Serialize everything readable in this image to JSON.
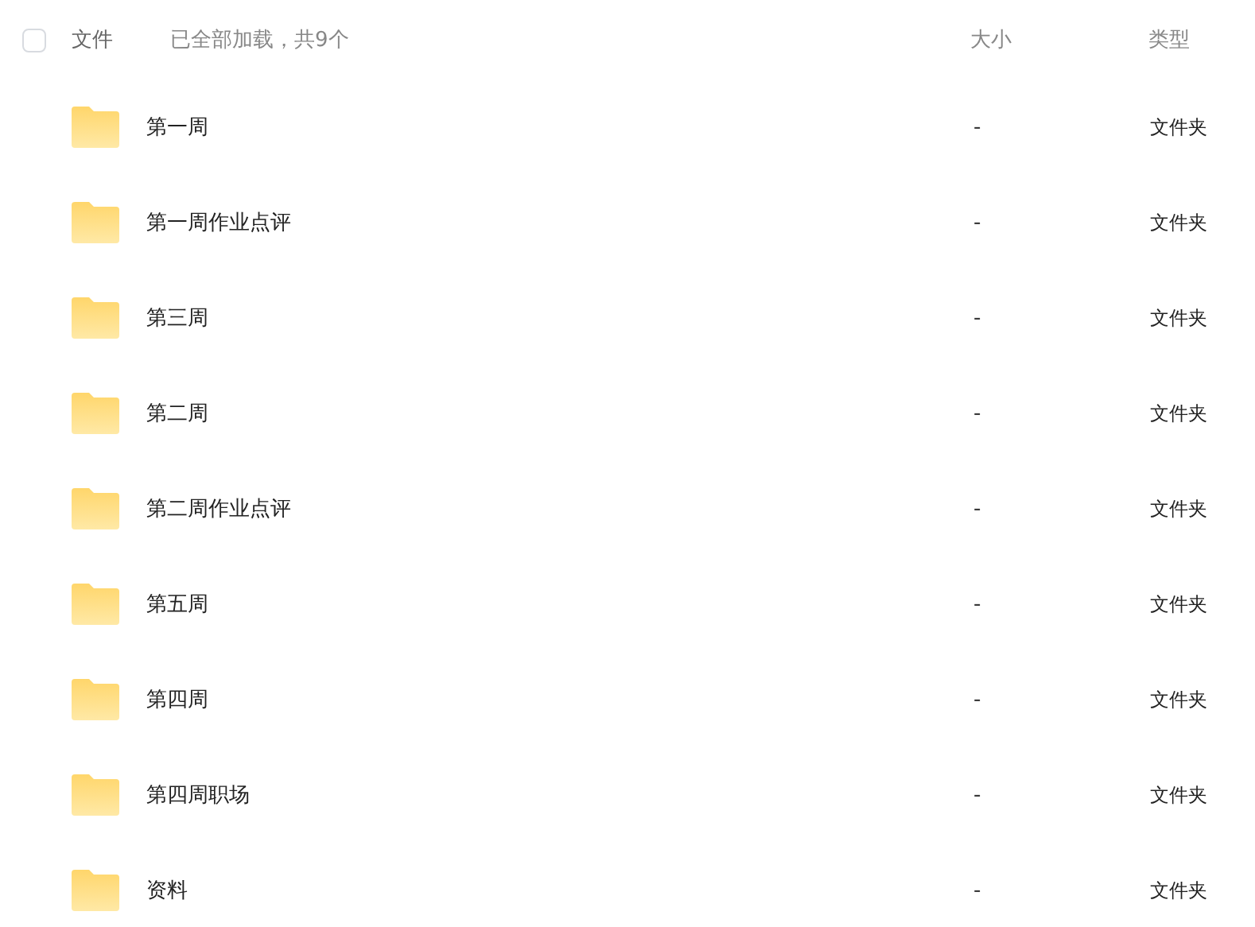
{
  "header": {
    "select_all": {
      "checked": false
    },
    "name_label": "文件",
    "load_status": "已全部加载，共9个",
    "size_label": "大小",
    "type_label": "类型"
  },
  "rows": [
    {
      "name": "第一周",
      "size": "-",
      "type": "文件夹"
    },
    {
      "name": "第一周作业点评",
      "size": "-",
      "type": "文件夹"
    },
    {
      "name": "第三周",
      "size": "-",
      "type": "文件夹"
    },
    {
      "name": "第二周",
      "size": "-",
      "type": "文件夹"
    },
    {
      "name": "第二周作业点评",
      "size": "-",
      "type": "文件夹"
    },
    {
      "name": "第五周",
      "size": "-",
      "type": "文件夹"
    },
    {
      "name": "第四周",
      "size": "-",
      "type": "文件夹"
    },
    {
      "name": "第四周职场",
      "size": "-",
      "type": "文件夹"
    },
    {
      "name": "资料",
      "size": "-",
      "type": "文件夹"
    }
  ]
}
